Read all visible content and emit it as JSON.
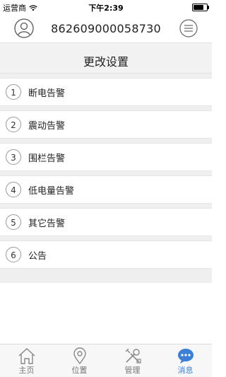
{
  "status_bar": {
    "carrier": "运营商",
    "time": "下午2:39",
    "battery_level": 0.85
  },
  "header": {
    "device_id": "862609000058730",
    "avatar_icon": "user-avatar-icon",
    "menu_icon": "list-menu-icon"
  },
  "page": {
    "title": "更改设置"
  },
  "settings": {
    "items": [
      {
        "number": "1",
        "label": "断电告警"
      },
      {
        "number": "2",
        "label": "震动告警"
      },
      {
        "number": "3",
        "label": "围栏告警"
      },
      {
        "number": "4",
        "label": "低电量告警"
      },
      {
        "number": "5",
        "label": "其它告警"
      },
      {
        "number": "6",
        "label": "公告"
      }
    ]
  },
  "tabbar": {
    "tabs": [
      {
        "label": "主页",
        "icon": "home-icon",
        "active": false
      },
      {
        "label": "位置",
        "icon": "location-pin-icon",
        "active": false
      },
      {
        "label": "管理",
        "icon": "tools-icon",
        "active": false
      },
      {
        "label": "消息",
        "icon": "message-bubble-icon",
        "active": true
      }
    ]
  },
  "colors": {
    "accent": "#3c7fd6",
    "background": "#efeff0",
    "tabbar": "#f7f7f7"
  }
}
